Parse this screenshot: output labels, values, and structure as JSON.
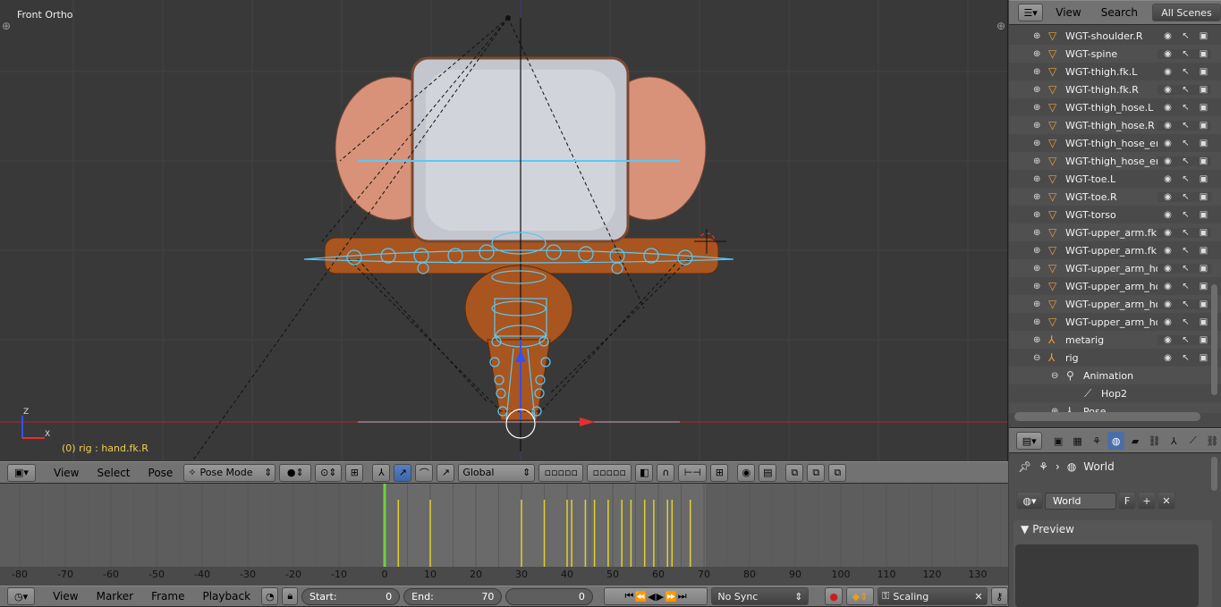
{
  "viewport": {
    "view_label": "Front Ortho",
    "object_label": "(0) rig : hand.fk.R",
    "colors": {
      "background": "#393939",
      "mesh": "#b8693a",
      "head": "#c9cbd3",
      "bones": "#5bc8f5",
      "x_axis": "#c83232"
    }
  },
  "viewport_header": {
    "menus": [
      "View",
      "Select",
      "Pose"
    ],
    "mode": "Pose Mode",
    "orientation": "Global"
  },
  "timeline": {
    "ticks": [
      "-80",
      "-70",
      "-60",
      "-50",
      "-40",
      "-30",
      "-20",
      "-10",
      "0",
      "10",
      "20",
      "30",
      "40",
      "50",
      "60",
      "70",
      "80",
      "90",
      "100",
      "110",
      "120",
      "130"
    ],
    "current_frame": 0,
    "keyframes": [
      3,
      10,
      30,
      35,
      40,
      41,
      44,
      46,
      49,
      52,
      54,
      57,
      59,
      62,
      63,
      67
    ]
  },
  "timeline_header": {
    "menus": [
      "View",
      "Marker",
      "Frame",
      "Playback"
    ],
    "start_label": "Start:",
    "start_value": "0",
    "end_label": "End:",
    "end_value": "70",
    "current_value": "0",
    "sync": "No Sync",
    "keying_set": "Scaling"
  },
  "outliner": {
    "header": {
      "view": "View",
      "search": "Search",
      "scenes": "All Scenes"
    },
    "items": [
      {
        "name": "WGT-shoulder.R",
        "type": "mesh"
      },
      {
        "name": "WGT-spine",
        "type": "mesh"
      },
      {
        "name": "WGT-thigh.fk.L",
        "type": "mesh"
      },
      {
        "name": "WGT-thigh.fk.R",
        "type": "mesh"
      },
      {
        "name": "WGT-thigh_hose.L",
        "type": "mesh"
      },
      {
        "name": "WGT-thigh_hose.R",
        "type": "mesh"
      },
      {
        "name": "WGT-thigh_hose_en",
        "type": "mesh"
      },
      {
        "name": "WGT-thigh_hose_en",
        "type": "mesh"
      },
      {
        "name": "WGT-toe.L",
        "type": "mesh"
      },
      {
        "name": "WGT-toe.R",
        "type": "mesh"
      },
      {
        "name": "WGT-torso",
        "type": "mesh"
      },
      {
        "name": "WGT-upper_arm.fk.l",
        "type": "mesh"
      },
      {
        "name": "WGT-upper_arm.fk.l",
        "type": "mesh"
      },
      {
        "name": "WGT-upper_arm_ho",
        "type": "mesh"
      },
      {
        "name": "WGT-upper_arm_ho",
        "type": "mesh"
      },
      {
        "name": "WGT-upper_arm_ho",
        "type": "mesh"
      },
      {
        "name": "WGT-upper_arm_ho",
        "type": "mesh"
      },
      {
        "name": "metarig",
        "type": "armature"
      },
      {
        "name": "rig",
        "type": "armature"
      },
      {
        "name": "Animation",
        "type": "anim"
      },
      {
        "name": "Hop2",
        "type": "action"
      },
      {
        "name": "Pose",
        "type": "pose"
      }
    ]
  },
  "properties": {
    "breadcrumb": "World",
    "world_field": "World",
    "fake_user": "F",
    "panel_title": "Preview"
  }
}
